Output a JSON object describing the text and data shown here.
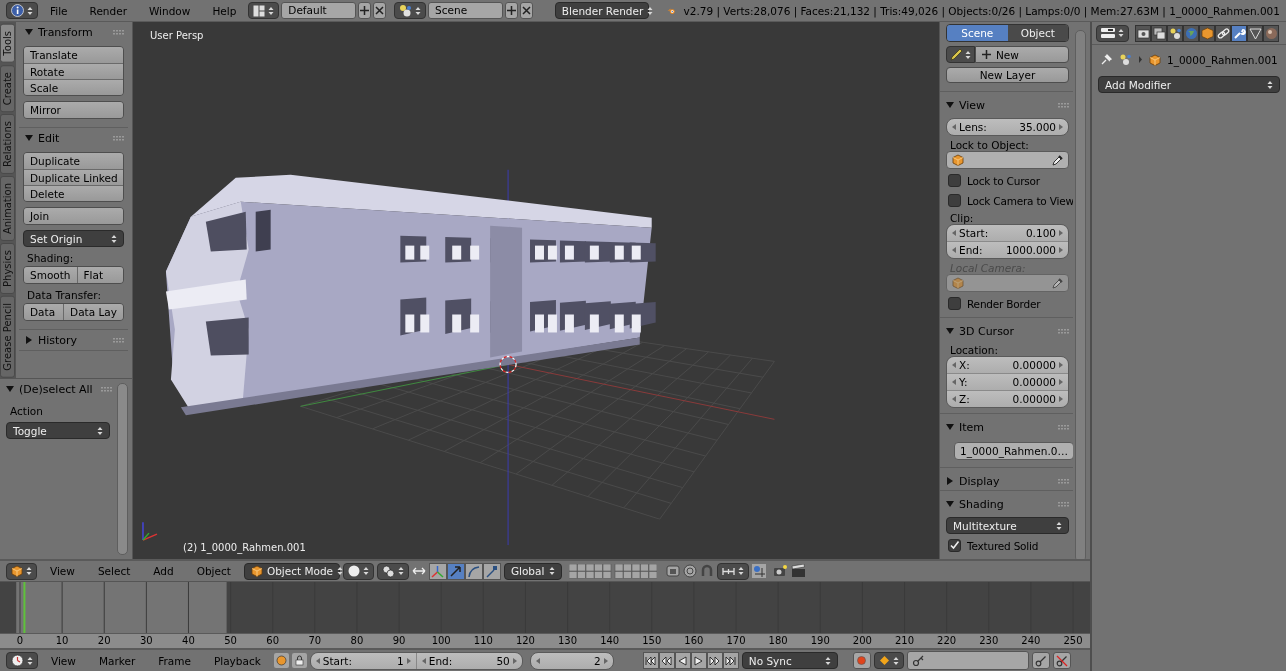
{
  "top_bar": {
    "menus": [
      "File",
      "Render",
      "Window",
      "Help"
    ],
    "screen_layout": "Default",
    "scene": "Scene",
    "render_engine": "Blender Render",
    "stats": "v2.79 | Verts:28,076 | Faces:21,132 | Tris:49,026 | Objects:0/26 | Lamps:0/0 | Mem:27.63M | 1_0000_Rahmen.001"
  },
  "tool_shelf": {
    "tabs": [
      {
        "label": "Tools",
        "selected": true
      },
      {
        "label": "Create",
        "selected": false
      },
      {
        "label": "Relations",
        "selected": false
      },
      {
        "label": "Animation",
        "selected": false
      },
      {
        "label": "Physics",
        "selected": false
      },
      {
        "label": "Grease Pencil",
        "selected": false
      }
    ],
    "panels": [
      {
        "title": "Transform",
        "expanded": true,
        "rows": [
          {
            "kind": "stack",
            "buttons": [
              "Translate",
              "Rotate",
              "Scale"
            ]
          },
          {
            "kind": "stack",
            "buttons": [
              "Mirror"
            ]
          }
        ]
      },
      {
        "title": "Edit",
        "expanded": true,
        "rows": [
          {
            "kind": "stack",
            "buttons": [
              "Duplicate",
              "Duplicate Linked",
              "Delete"
            ]
          },
          {
            "kind": "stack",
            "buttons": [
              "Join"
            ]
          },
          {
            "kind": "dropdown",
            "value": "Set Origin"
          },
          {
            "kind": "label",
            "text": "Shading:",
            "disabled": false
          },
          {
            "kind": "pair",
            "buttons": [
              "Smooth",
              "Flat"
            ]
          },
          {
            "kind": "label",
            "text": "Data Transfer:",
            "disabled": false
          },
          {
            "kind": "pair",
            "buttons": [
              "Data",
              "Data Lay"
            ]
          }
        ]
      },
      {
        "title": "History",
        "expanded": false
      }
    ]
  },
  "operator_panel": {
    "title": "(De)select All",
    "expanded": true,
    "label": "Action",
    "value": "Toggle"
  },
  "viewport": {
    "view_name": "User Persp",
    "object_info": "(2) 1_0000_Rahmen.001"
  },
  "n_panel": {
    "tabs": [
      {
        "label": "Scene",
        "selected": true
      },
      {
        "label": "Object",
        "selected": false
      }
    ],
    "layer_button": "New",
    "new_layer_button": "New Layer",
    "panels": [
      {
        "title": "View",
        "expanded": true,
        "rows": [
          {
            "kind": "number",
            "label": "Lens:",
            "value": "35.000"
          },
          {
            "kind": "label",
            "text": "Lock to Object:",
            "disabled": false
          },
          {
            "kind": "object",
            "disabled": false
          },
          {
            "kind": "checkbox",
            "label": "Lock to Cursor",
            "checked": false
          },
          {
            "kind": "checkbox",
            "label": "Lock Camera to View",
            "checked": false
          },
          {
            "kind": "label",
            "text": "Clip:",
            "disabled": false
          },
          {
            "kind": "numbers",
            "fields": [
              {
                "label": "Start:",
                "value": "0.100"
              },
              {
                "label": "End:",
                "value": "1000.000"
              }
            ]
          },
          {
            "kind": "label",
            "text": "Local Camera:",
            "disabled": true
          },
          {
            "kind": "object",
            "disabled": true
          },
          {
            "kind": "checkbox",
            "label": "Render Border",
            "checked": false
          }
        ]
      },
      {
        "title": "3D Cursor",
        "expanded": true,
        "rows": [
          {
            "kind": "label",
            "text": "Location:",
            "disabled": false
          },
          {
            "kind": "numbers",
            "fields": [
              {
                "label": "X:",
                "value": "0.00000"
              },
              {
                "label": "Y:",
                "value": "0.00000"
              },
              {
                "label": "Z:",
                "value": "0.00000"
              }
            ]
          }
        ]
      },
      {
        "title": "Item",
        "expanded": true,
        "rows": [
          {
            "kind": "item",
            "value": "1_0000_Rahmen.0…"
          }
        ]
      },
      {
        "title": "Display",
        "expanded": false
      },
      {
        "title": "Shading",
        "expanded": true,
        "rows": [
          {
            "kind": "dropdown",
            "value": "Multitexture"
          },
          {
            "kind": "checkbox",
            "label": "Textured Solid",
            "checked": true
          }
        ]
      }
    ]
  },
  "view3d_header": {
    "menus": [
      "View",
      "Select",
      "Add",
      "Object"
    ],
    "mode": "Object Mode",
    "orientation": "Global",
    "manipulators": [
      {
        "selected": false
      },
      {
        "selected": true
      },
      {
        "selected": false
      },
      {
        "selected": false
      }
    ]
  },
  "timeline": {
    "ruler": [
      "0",
      "10",
      "20",
      "30",
      "40",
      "50",
      "60",
      "70",
      "80",
      "90",
      "100",
      "110",
      "120",
      "130",
      "140",
      "150",
      "160",
      "170",
      "180",
      "190",
      "200",
      "210",
      "220",
      "230",
      "240",
      "250"
    ]
  },
  "timeline_header": {
    "menus": [
      "View",
      "Marker",
      "Frame",
      "Playback"
    ],
    "start": {
      "label": "Start:",
      "value": "1"
    },
    "end": {
      "label": "End:",
      "value": "50"
    },
    "current_frame": "2",
    "sync": "No Sync"
  },
  "properties": {
    "tabs": [
      {
        "selected": false
      },
      {
        "selected": false
      },
      {
        "selected": false
      },
      {
        "selected": false
      },
      {
        "selected": false
      },
      {
        "selected": false
      },
      {
        "selected": true
      },
      {
        "selected": false
      },
      {
        "selected": false
      }
    ],
    "breadcrumb": "1_0000_Rahmen.001",
    "add_modifier": "Add Modifier"
  }
}
